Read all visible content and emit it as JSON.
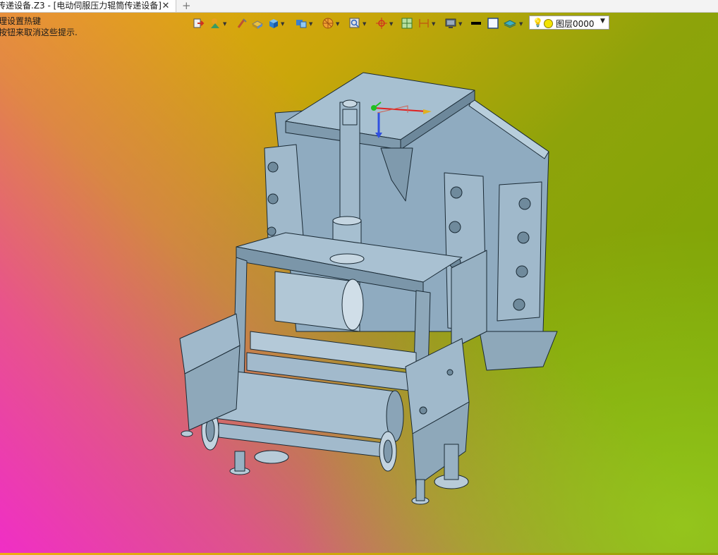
{
  "window": {
    "tab_title": "传递设备.Z3 - [电动伺服压力辊筒传递设备]",
    "close_glyph": "✕",
    "add_glyph": "+"
  },
  "hints": {
    "line1": "理设置热键",
    "line2": "按钮来取消这些提示."
  },
  "toolbar": {
    "icons": [
      "exit-icon",
      "shade-icon",
      "brush-icon",
      "block-icon",
      "cube-icon",
      "view-icon",
      "render-icon",
      "zoom-icon",
      "snap-icon",
      "grid-icon",
      "dimension-icon",
      "monitor-icon",
      "line-icon",
      "square-icon",
      "layer-stack-icon"
    ],
    "layer": {
      "bulb": "💡",
      "name": "图层0000",
      "arrow": "▼"
    }
  },
  "colors": {
    "model_fill": "#9bb7c9",
    "model_stroke": "#1a2a35",
    "axis_x": "#e02020",
    "axis_y": "#20c020",
    "axis_z": "#3050e0"
  },
  "viewport": {
    "content": "3D CAD model of electric servo pressure roller transfer device"
  }
}
